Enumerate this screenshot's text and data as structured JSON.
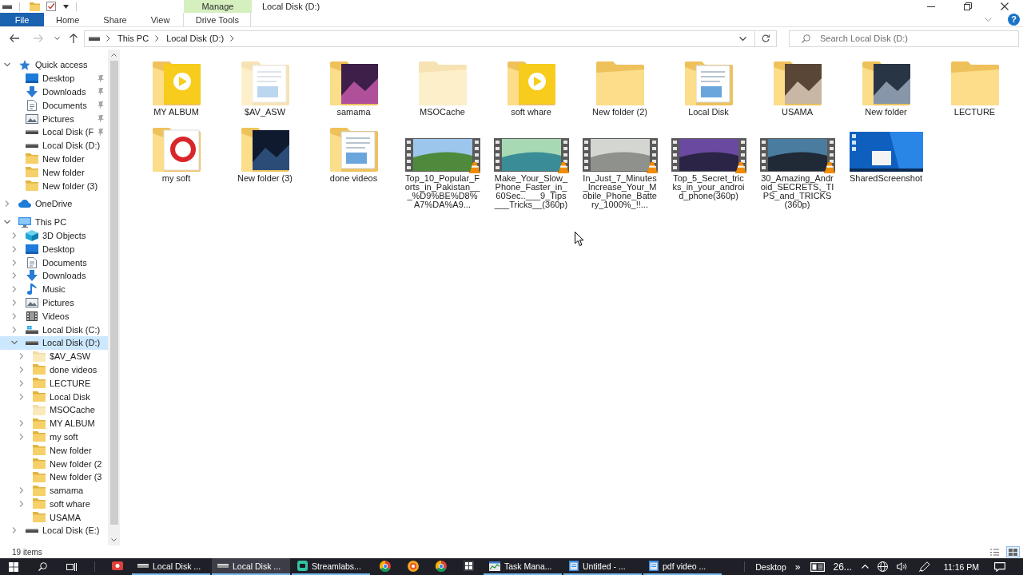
{
  "window": {
    "title": "Local Disk (D:)",
    "context_group": "Manage"
  },
  "ribbon": {
    "tabs": [
      {
        "label": "File",
        "kind": "file",
        "selected": false
      },
      {
        "label": "Home",
        "kind": "tab",
        "selected": false
      },
      {
        "label": "Share",
        "kind": "tab",
        "selected": false
      },
      {
        "label": "View",
        "kind": "tab",
        "selected": false
      },
      {
        "label": "Drive Tools",
        "kind": "context",
        "selected": false
      }
    ],
    "help": "?"
  },
  "navigation": [
    {
      "kind": "back",
      "disabled": false
    },
    {
      "kind": "forward",
      "disabled": true
    },
    {
      "kind": "recent",
      "disabled": false
    },
    {
      "kind": "up",
      "disabled": false
    }
  ],
  "address": {
    "crumbs": [
      "This PC",
      "Local Disk (D:)"
    ]
  },
  "search": {
    "placeholder": "Search Local Disk (D:)"
  },
  "nav_pane": {
    "tree": [
      {
        "label": "Quick access",
        "kind": "star",
        "expandable": true,
        "expanded": true,
        "selected": false,
        "children": [
          {
            "label": "Desktop",
            "kind": "desktop",
            "expandable": false,
            "expanded": false,
            "selected": false,
            "pinned": true
          },
          {
            "label": "Downloads",
            "kind": "downloads",
            "expandable": false,
            "expanded": false,
            "selected": false,
            "pinned": true
          },
          {
            "label": "Documents",
            "kind": "documents",
            "expandable": false,
            "expanded": false,
            "selected": false,
            "pinned": true
          },
          {
            "label": "Pictures",
            "kind": "pictures",
            "expandable": false,
            "expanded": false,
            "selected": false,
            "pinned": true
          },
          {
            "label": "Local Disk (F",
            "kind": "drive",
            "expandable": false,
            "expanded": false,
            "selected": false,
            "pinned": true
          },
          {
            "label": "Local Disk (D:)",
            "kind": "drive",
            "expandable": false,
            "expanded": false,
            "selected": false,
            "pinned": false
          },
          {
            "label": "New folder",
            "kind": "folder",
            "expandable": false,
            "expanded": false,
            "selected": false,
            "pinned": false
          },
          {
            "label": "New folder",
            "kind": "folder",
            "expandable": false,
            "expanded": false,
            "selected": false,
            "pinned": false
          },
          {
            "label": "New folder (3)",
            "kind": "folder",
            "expandable": false,
            "expanded": false,
            "selected": false,
            "pinned": false
          }
        ]
      },
      {
        "label": "OneDrive",
        "kind": "cloud",
        "expandable": true,
        "expanded": false,
        "selected": false
      },
      {
        "label": "This PC",
        "kind": "pc",
        "expandable": true,
        "expanded": true,
        "selected": false,
        "children": [
          {
            "label": "3D Objects",
            "kind": "objects",
            "expandable": true,
            "expanded": false,
            "selected": false
          },
          {
            "label": "Desktop",
            "kind": "desktop",
            "expandable": true,
            "expanded": false,
            "selected": false
          },
          {
            "label": "Documents",
            "kind": "documents",
            "expandable": true,
            "expanded": false,
            "selected": false
          },
          {
            "label": "Downloads",
            "kind": "downloads",
            "expandable": true,
            "expanded": false,
            "selected": false
          },
          {
            "label": "Music",
            "kind": "music",
            "expandable": true,
            "expanded": false,
            "selected": false
          },
          {
            "label": "Pictures",
            "kind": "pictures",
            "expandable": true,
            "expanded": false,
            "selected": false
          },
          {
            "label": "Videos",
            "kind": "videos",
            "expandable": true,
            "expanded": false,
            "selected": false
          },
          {
            "label": "Local Disk (C:)",
            "kind": "system-drive",
            "expandable": true,
            "expanded": false,
            "selected": false
          },
          {
            "label": "Local Disk (D:)",
            "kind": "drive",
            "expandable": true,
            "expanded": true,
            "selected": true,
            "children": [
              {
                "label": "$AV_ASW",
                "kind": "folder",
                "expandable": true,
                "expanded": false,
                "selected": false,
                "hidden": true
              },
              {
                "label": "done videos",
                "kind": "folder",
                "expandable": true,
                "expanded": false,
                "selected": false,
                "hidden": false
              },
              {
                "label": "LECTURE",
                "kind": "folder",
                "expandable": true,
                "expanded": false,
                "selected": false,
                "hidden": false
              },
              {
                "label": "Local Disk",
                "kind": "folder",
                "expandable": true,
                "expanded": false,
                "selected": false,
                "hidden": false
              },
              {
                "label": "MSOCache",
                "kind": "folder",
                "expandable": false,
                "expanded": false,
                "selected": false,
                "hidden": true
              },
              {
                "label": "MY ALBUM",
                "kind": "folder",
                "expandable": true,
                "expanded": false,
                "selected": false,
                "hidden": false
              },
              {
                "label": "my soft",
                "kind": "folder",
                "expandable": true,
                "expanded": false,
                "selected": false,
                "hidden": false
              },
              {
                "label": "New folder",
                "kind": "folder",
                "expandable": false,
                "expanded": false,
                "selected": false,
                "hidden": false
              },
              {
                "label": "New folder (2",
                "kind": "folder",
                "expandable": false,
                "expanded": false,
                "selected": false,
                "hidden": false
              },
              {
                "label": "New folder (3",
                "kind": "folder",
                "expandable": false,
                "expanded": false,
                "selected": false,
                "hidden": false
              },
              {
                "label": "samama",
                "kind": "folder",
                "expandable": true,
                "expanded": false,
                "selected": false,
                "hidden": false
              },
              {
                "label": "soft whare",
                "kind": "folder",
                "expandable": true,
                "expanded": false,
                "selected": false,
                "hidden": false
              },
              {
                "label": "USAMA",
                "kind": "folder",
                "expandable": false,
                "expanded": false,
                "selected": false,
                "hidden": false
              }
            ]
          },
          {
            "label": "Local Disk (E:)",
            "kind": "drive",
            "expandable": true,
            "expanded": false,
            "selected": false
          }
        ]
      }
    ]
  },
  "items": [
    {
      "name": "MY ALBUM",
      "kind": "play-folder",
      "hidden": false
    },
    {
      "name": "$AV_ASW",
      "kind": "paper-folder",
      "hidden": true
    },
    {
      "name": "samama",
      "kind": "photo-folder",
      "hidden": false
    },
    {
      "name": "MSOCache",
      "kind": "folder",
      "hidden": true
    },
    {
      "name": "soft whare",
      "kind": "play-folder",
      "hidden": false
    },
    {
      "name": "New folder (2)",
      "kind": "folder",
      "hidden": false
    },
    {
      "name": "Local Disk",
      "kind": "paper-folder",
      "hidden": false
    },
    {
      "name": "USAMA",
      "kind": "photo-folder",
      "hidden": false
    },
    {
      "name": "New folder",
      "kind": "photo-folder",
      "hidden": false
    },
    {
      "name": "LECTURE",
      "kind": "folder",
      "hidden": false
    },
    {
      "name": "my soft",
      "kind": "ring-folder",
      "hidden": false
    },
    {
      "name": "New folder (3)",
      "kind": "photo-folder",
      "hidden": false
    },
    {
      "name": "done videos",
      "kind": "paper-folder",
      "hidden": false
    },
    {
      "name": "Top_10_Popular_Forts_in_Pakistan___%D9%BE%D8%A7%DA%A9...",
      "kind": "video",
      "hidden": false
    },
    {
      "name": "Make_Your_Slow_Phone_Faster_in_60Sec..___9_Tips___Tricks__(360p)",
      "kind": "video",
      "hidden": false
    },
    {
      "name": "In_Just_7_Minutes_Increase_Your_Mobile_Phone_Battery_1000%_!!...",
      "kind": "video",
      "hidden": false
    },
    {
      "name": "Top_5_Secret_tricks_in_your_android_phone(360p)",
      "kind": "video",
      "hidden": false
    },
    {
      "name": "30_Amazing_Android_SECRETS,_TIPS_and_TRICKS(360p)",
      "kind": "video",
      "hidden": false
    },
    {
      "name": "SharedScreenshot",
      "kind": "screenshot",
      "hidden": false
    }
  ],
  "status_bar": {
    "count": "19 items",
    "views": [
      {
        "kind": "details",
        "selected": false
      },
      {
        "kind": "large-icons",
        "selected": true
      }
    ]
  },
  "taskbar": {
    "apps": [
      {
        "kind": "recorder",
        "running": false,
        "selected": false
      },
      {
        "kind": "drive",
        "label": "Local Disk ...",
        "running": true,
        "selected": false
      },
      {
        "kind": "drive",
        "label": "Local Disk ...",
        "running": true,
        "selected": true
      },
      {
        "kind": "streamlabs",
        "label": "Streamlabs...",
        "running": true,
        "selected": false
      },
      {
        "kind": "browser",
        "running": false,
        "selected": false
      },
      {
        "kind": "orange-browser",
        "running": false,
        "selected": false
      },
      {
        "kind": "browser",
        "running": false,
        "selected": false
      },
      {
        "kind": "grid",
        "running": false,
        "selected": false
      },
      {
        "kind": "task-manager",
        "label": "Task Mana...",
        "running": true,
        "selected": false
      },
      {
        "kind": "notepad",
        "label": "Untitled - ...",
        "running": true,
        "selected": false
      },
      {
        "kind": "notepad",
        "label": "pdf  video ...",
        "running": true,
        "selected": false
      }
    ],
    "toolbar": "Desktop",
    "toolbar_more": "»",
    "widget": "26...",
    "clock": "11:16 PM"
  }
}
